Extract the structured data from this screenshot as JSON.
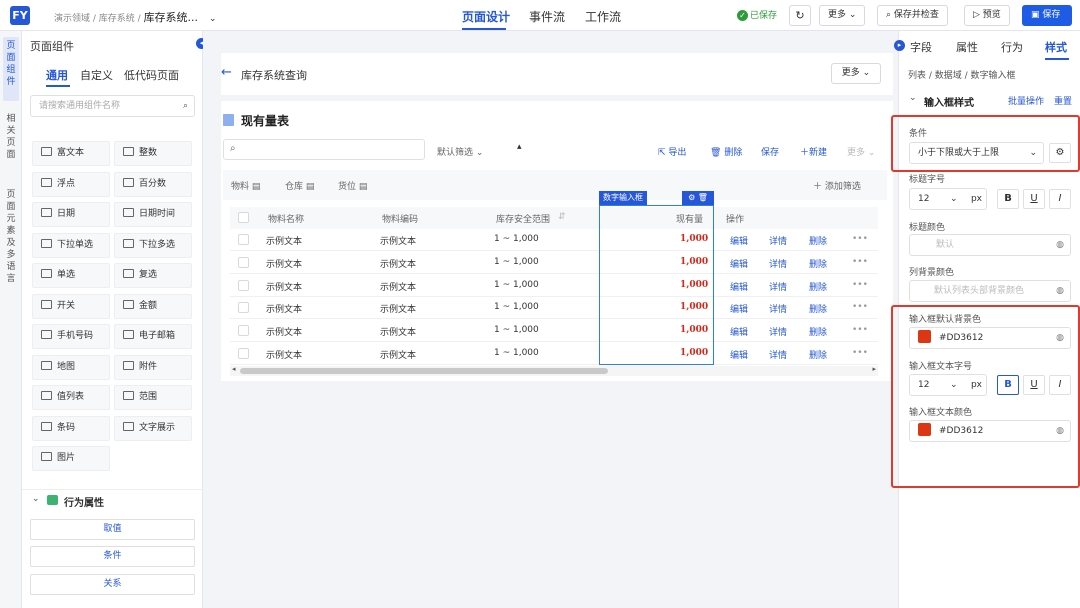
{
  "topbar": {
    "logo": "FY",
    "breadcrumb_1": "演示领域 /",
    "breadcrumb_2": "库存系统 /",
    "breadcrumb_3": "库存系统...",
    "nav": [
      "页面设计",
      "事件流",
      "工作流"
    ],
    "saved_label": "已保存",
    "more_label": "更多",
    "save_check_label": "保存并检查",
    "preview_label": "预览",
    "save_label": "保存"
  },
  "side_strip": [
    "页面组件",
    "相关页面",
    "页面元素及多语言"
  ],
  "left_panel": {
    "title": "页面组件",
    "tabs": [
      "通用",
      "自定义",
      "低代码页面"
    ],
    "search_placeholder": "请搜索通用组件名称",
    "components": [
      "富文本",
      "整数",
      "浮点",
      "百分数",
      "日期",
      "日期时间",
      "下拉单选",
      "下拉多选",
      "单选",
      "复选",
      "开关",
      "金额",
      "手机号码",
      "电子邮箱",
      "地图",
      "附件",
      "值列表",
      "范围",
      "条码",
      "文字展示",
      "图片"
    ],
    "section_title": "行为属性",
    "actions": [
      "取值",
      "条件",
      "关系"
    ]
  },
  "canvas": {
    "page_title": "库存系统查询",
    "more_label": "更多",
    "card_title": "现有量表",
    "default_filter": "默认筛选",
    "toolbar": [
      "导出",
      "删除",
      "保存",
      "新建",
      "更多"
    ],
    "filters": [
      "物料",
      "仓库",
      "货位"
    ],
    "add_filter": "添加筛选",
    "selected_tag": "数字输入框",
    "columns": [
      "物料名称",
      "物料编码",
      "库存安全范围",
      "现有量",
      "操作"
    ],
    "rows": [
      {
        "name": "示例文本",
        "code": "示例文本",
        "range": "1 ~ 1,000",
        "qty": "1,000"
      },
      {
        "name": "示例文本",
        "code": "示例文本",
        "range": "1 ~ 1,000",
        "qty": "1,000"
      },
      {
        "name": "示例文本",
        "code": "示例文本",
        "range": "1 ~ 1,000",
        "qty": "1,000"
      },
      {
        "name": "示例文本",
        "code": "示例文本",
        "range": "1 ~ 1,000",
        "qty": "1,000"
      },
      {
        "name": "示例文本",
        "code": "示例文本",
        "range": "1 ~ 1,000",
        "qty": "1,000"
      },
      {
        "name": "示例文本",
        "code": "示例文本",
        "range": "1 ~ 1,000",
        "qty": "1,000"
      }
    ],
    "row_actions": [
      "编辑",
      "详情",
      "删除",
      "•••"
    ]
  },
  "right_panel": {
    "tabs": [
      "字段",
      "属性",
      "行为",
      "样式"
    ],
    "breadcrumb": "列表 / 数据域 / 数字输入框",
    "section_title": "输入框样式",
    "batch_label": "批量操作",
    "reset_label": "重置",
    "condition_label": "条件",
    "condition_value": "小于下限或大于上限",
    "title_font_label": "标题字号",
    "title_font_value": "12",
    "unit": "px",
    "title_color_label": "标题颜色",
    "title_color_placeholder": "默认",
    "col_bg_label": "列背景颜色",
    "col_bg_placeholder": "默认列表头部背景颜色",
    "input_bg_label": "输入框默认背景色",
    "input_bg_value": "#DD3612",
    "input_font_label": "输入框文本字号",
    "input_font_value": "12",
    "input_color_label": "输入框文本颜色",
    "input_color_value": "#DD3612",
    "accent_color": "#DD3612"
  }
}
